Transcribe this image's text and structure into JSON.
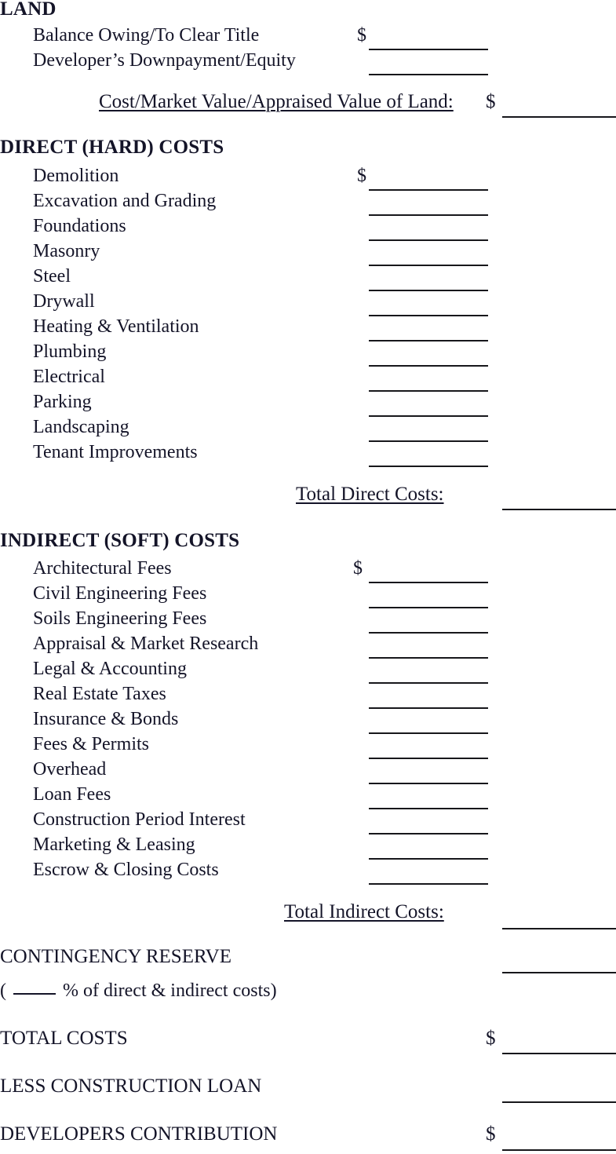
{
  "document": {
    "currency_symbol": "$",
    "text_color": "#141428",
    "rule_color": "#17171b",
    "background": "#ffffff"
  },
  "sections": [
    {
      "heading": "LAND",
      "items": [
        {
          "label": "Balance Owing/To Clear Title",
          "has_dollar": true,
          "blank": "inner"
        },
        {
          "label": "Developer’s Downpayment/Equity",
          "has_dollar": false,
          "blank": "inner"
        }
      ],
      "total": {
        "label": "Cost/Market Value/Appraised Value of Land:",
        "has_dollar": true,
        "blank": "outer"
      }
    },
    {
      "heading": "DIRECT (HARD) COSTS",
      "items": [
        {
          "label": "Demolition",
          "has_dollar": true,
          "blank": "inner"
        },
        {
          "label": "Excavation and Grading",
          "has_dollar": false,
          "blank": "inner"
        },
        {
          "label": "Foundations",
          "has_dollar": false,
          "blank": "inner"
        },
        {
          "label": "Masonry",
          "has_dollar": false,
          "blank": "inner"
        },
        {
          "label": "Steel",
          "has_dollar": false,
          "blank": "inner"
        },
        {
          "label": "Drywall",
          "has_dollar": false,
          "blank": "inner"
        },
        {
          "label": "Heating & Ventilation",
          "has_dollar": false,
          "blank": "inner"
        },
        {
          "label": "Plumbing",
          "has_dollar": false,
          "blank": "inner"
        },
        {
          "label": "Electrical",
          "has_dollar": false,
          "blank": "inner"
        },
        {
          "label": "Parking",
          "has_dollar": false,
          "blank": "inner"
        },
        {
          "label": "Landscaping",
          "has_dollar": false,
          "blank": "inner"
        },
        {
          "label": "Tenant Improvements",
          "has_dollar": false,
          "blank": "inner"
        }
      ],
      "total": {
        "label": "Total Direct Costs:",
        "has_dollar": false,
        "blank": "outer"
      }
    },
    {
      "heading": "INDIRECT (SOFT) COSTS",
      "items": [
        {
          "label": "Architectural Fees",
          "has_dollar": true,
          "blank": "inner"
        },
        {
          "label": "Civil Engineering Fees",
          "has_dollar": false,
          "blank": "inner"
        },
        {
          "label": "Soils Engineering Fees",
          "has_dollar": false,
          "blank": "inner"
        },
        {
          "label": "Appraisal & Market Research",
          "has_dollar": false,
          "blank": "inner"
        },
        {
          "label": "Legal & Accounting",
          "has_dollar": false,
          "blank": "inner"
        },
        {
          "label": "Real Estate Taxes",
          "has_dollar": false,
          "blank": "inner"
        },
        {
          "label": "Insurance & Bonds",
          "has_dollar": false,
          "blank": "inner"
        },
        {
          "label": "Fees & Permits",
          "has_dollar": false,
          "blank": "inner"
        },
        {
          "label": "Overhead",
          "has_dollar": false,
          "blank": "inner"
        },
        {
          "label": "Loan Fees",
          "has_dollar": false,
          "blank": "inner"
        },
        {
          "label": "Construction Period Interest",
          "has_dollar": false,
          "blank": "inner"
        },
        {
          "label": "Marketing & Leasing",
          "has_dollar": false,
          "blank": "inner"
        },
        {
          "label": "Escrow & Closing Costs",
          "has_dollar": false,
          "blank": "inner"
        }
      ],
      "total": {
        "label": "Total Indirect Costs:",
        "has_dollar": false,
        "blank": "outer"
      }
    }
  ],
  "summary": {
    "contingency_label": "CONTINGENCY RESERVE",
    "contingency_note_before": "( ",
    "contingency_note_after": " % of direct & indirect costs)",
    "total_costs_label": "TOTAL COSTS",
    "less_loan_label": "LESS CONSTRUCTION LOAN",
    "developers_contribution_label": "DEVELOPERS CONTRIBUTION"
  }
}
